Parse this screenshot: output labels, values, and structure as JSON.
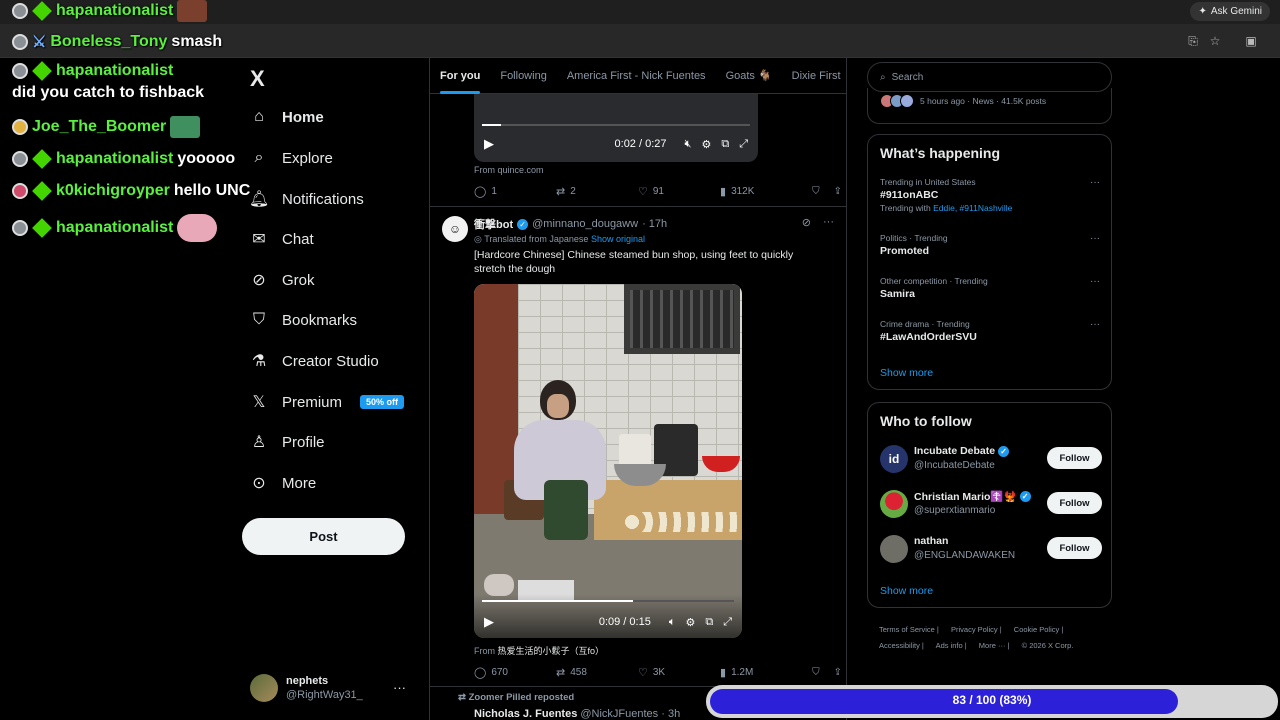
{
  "browser": {
    "gemini_label": "Ask Gemini"
  },
  "chat": [
    {
      "user": "hapanationalist",
      "message": ""
    },
    {
      "user": "Boneless_Tony",
      "message": "smash"
    },
    {
      "user": "hapanationalist",
      "message": ""
    },
    {
      "user": "",
      "message": "did you catch to fishback"
    },
    {
      "user": "Joe_The_Boomer",
      "message": ""
    },
    {
      "user": "hapanationalist",
      "message": "yooooo"
    },
    {
      "user": "k0kichigroyper",
      "message": "hello UNC"
    },
    {
      "user": "hapanationalist",
      "message": ""
    }
  ],
  "nav": {
    "logo": "X",
    "items": [
      {
        "label": "Home",
        "icon": "home-icon"
      },
      {
        "label": "Explore",
        "icon": "search-icon"
      },
      {
        "label": "Notifications",
        "icon": "bell-icon"
      },
      {
        "label": "Chat",
        "icon": "mail-icon"
      },
      {
        "label": "Grok",
        "icon": "grok-icon"
      },
      {
        "label": "Bookmarks",
        "icon": "bookmark-icon"
      },
      {
        "label": "Creator Studio",
        "icon": "flask-icon"
      },
      {
        "label": "Premium",
        "icon": "x-icon"
      },
      {
        "label": "Profile",
        "icon": "person-icon"
      },
      {
        "label": "More",
        "icon": "more-circle-icon"
      }
    ],
    "premium_badge": "50% off",
    "post_label": "Post",
    "account": {
      "name": "nephets",
      "handle": "@RightWay31_"
    }
  },
  "timeline": {
    "tabs": [
      "For you",
      "Following",
      "America First - Nick Fuentes",
      "Goats 🐐",
      "Dixie First"
    ],
    "tweet1": {
      "video_time": "0:02 / 0:27",
      "video_progress": 0.07,
      "source": "From quince.com",
      "replies": "1",
      "reposts": "2",
      "likes": "91",
      "views": "312K"
    },
    "tweet2": {
      "name": "衝撃bot",
      "handle": "@minnano_dougaww",
      "time": "· 17h",
      "translated": "Translated from Japanese",
      "show_original": "Show original",
      "text": "[Hardcore Chinese] Chinese steamed bun shop, using feet to quickly stretch the dough",
      "video_time": "0:09 / 0:15",
      "video_progress": 0.6,
      "source_prefix": "From",
      "source_name": "热爱生活的小鬏子（互fo）",
      "replies": "670",
      "reposts": "458",
      "likes": "3K",
      "views": "1.2M"
    },
    "tweet3": {
      "reposted": "Zoomer Pilled reposted",
      "name": "Nicholas J. Fuentes",
      "handle": "@NickJFuentes · 3h"
    }
  },
  "right": {
    "search_placeholder": "Search",
    "news_meta": "5 hours ago · News · 41.5K posts",
    "happening_title": "What’s happening",
    "trends": [
      {
        "context": "Trending in United States",
        "name": "#911onABC",
        "with_prefix": "Trending with",
        "with": "Eddie, #911Nashville"
      },
      {
        "context": "Politics · Trending",
        "name": "Promoted",
        "with_prefix": "",
        "with": ""
      },
      {
        "context": "Other competition · Trending",
        "name": "Samira",
        "with_prefix": "",
        "with": ""
      },
      {
        "context": "Crime drama · Trending",
        "name": "#LawAndOrderSVU",
        "with_prefix": "",
        "with": ""
      }
    ],
    "show_more": "Show more",
    "wtf_title": "Who to follow",
    "who_to_follow": [
      {
        "name": "Incubate Debate",
        "handle": "@IncubateDebate",
        "avatar_text": "id"
      },
      {
        "name": "Christian Mario☦️🐦‍🔥",
        "handle": "@superxtianmario",
        "avatar_text": ""
      },
      {
        "name": "nathan",
        "handle": "@ENGLANDAWAKEN",
        "avatar_text": ""
      }
    ],
    "follow_label": "Follow",
    "footer": [
      "Terms of Service |",
      "Privacy Policy |",
      "Cookie Policy |",
      "Accessibility |",
      "Ads info |",
      "More ··· |",
      "© 2026 X Corp."
    ]
  },
  "progress": {
    "text": "83 / 100 (83%)",
    "value": 0.83
  }
}
